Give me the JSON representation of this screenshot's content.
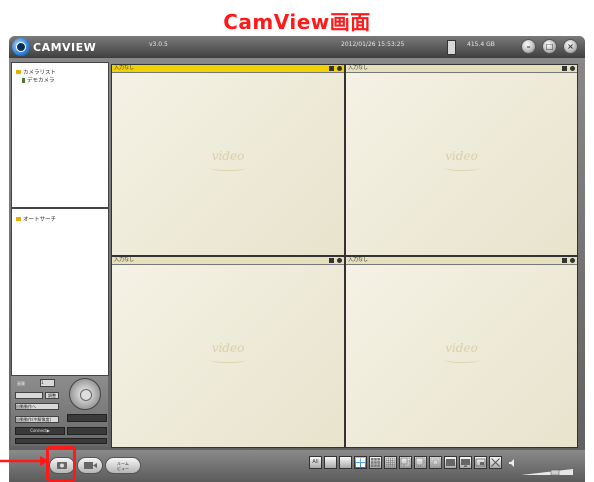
{
  "caption": "CamView画面",
  "app": {
    "logo_text": "CAMVIEW",
    "version": "v3.0.5",
    "datetime": "2012/01/26 15:53:25",
    "disk_free": "415.4 GB"
  },
  "tree": {
    "camera_list_label": "カメラリスト",
    "demo_camera_label": "デモカメラ"
  },
  "autosearch": {
    "label": "オートサーチ"
  },
  "controls": {
    "label_1": "画質",
    "select_1": "1",
    "button_1": "調整",
    "select_2": "自動動作へ",
    "select_3": "自動動作(中解像度)",
    "dark_button": "Connect▶"
  },
  "videos": [
    {
      "label": "入力なし",
      "watermark": "video"
    },
    {
      "label": "入力なし",
      "watermark": "video"
    },
    {
      "label": "入力なし",
      "watermark": "video"
    },
    {
      "label": "入力なし",
      "watermark": "video"
    }
  ],
  "bottom": {
    "left_buttons": [
      "",
      "",
      "ルーム\nビュー"
    ],
    "layouts": [
      "All",
      "",
      "",
      "",
      "",
      "",
      "",
      "",
      "",
      "",
      "",
      ""
    ]
  },
  "colors": {
    "caption": "#ff1a1a",
    "active_title": "#f2d100",
    "highlight_box": "#ff1a1a",
    "pointer_arrow": "#ff1a1a"
  }
}
